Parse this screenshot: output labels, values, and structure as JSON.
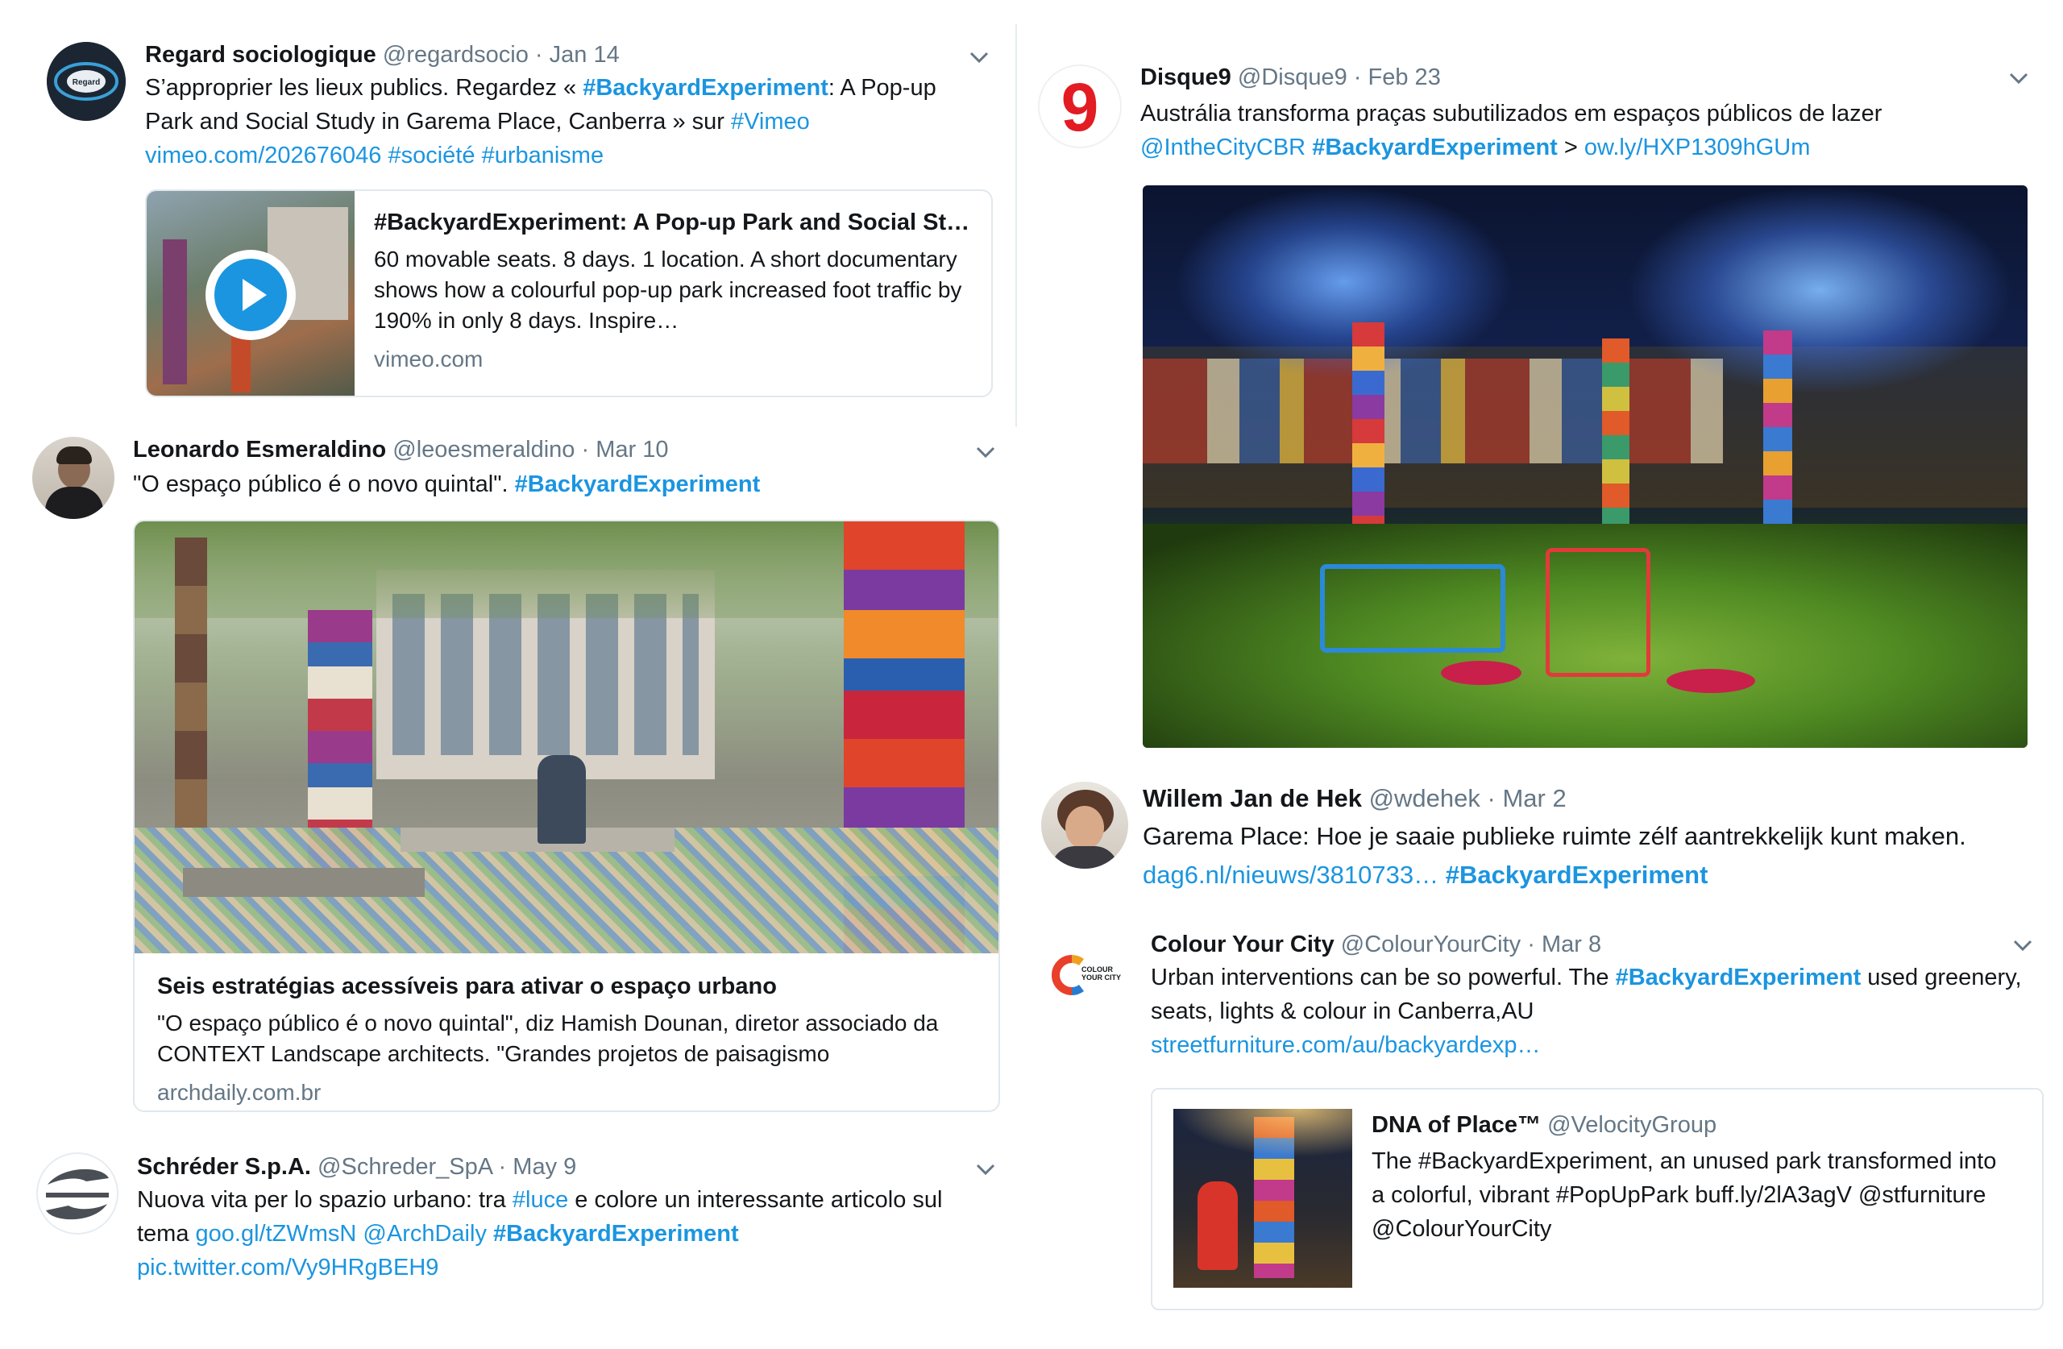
{
  "tweets": [
    {
      "name": "Regard sociologique",
      "handle": "@regardsocio",
      "sep": "·",
      "date": "Jan 14",
      "avatar_label": "Regard",
      "text": {
        "p1": "S’approprier les lieux publics.  Regardez « ",
        "tag1": "#BackyardExperiment",
        "p2": ": A Pop-up Park and Social Study in Garema Place, Canberra » sur ",
        "tag2": "#Vimeo",
        "link1": "vimeo.com/202676046",
        "tag3": "#société",
        "tag4": "#urbanisme"
      },
      "card": {
        "title": "#BackyardExperiment: A Pop-up Park and Social St…",
        "description": "60 movable seats. 8 days. 1 location. A short documentary shows how a colourful pop-up park increased foot traffic by 190% in only 8 days. Inspire…",
        "domain": "vimeo.com",
        "play_icon": "play-icon"
      }
    },
    {
      "name": "Leonardo Esmeraldino",
      "handle": "@leoesmeraldino",
      "sep": "·",
      "date": "Mar 10",
      "text": {
        "p1": "\"O espaço público é o novo quintal\". ",
        "tag1": "#BackyardExperiment"
      },
      "card": {
        "title": "Seis estratégias acessíveis para ativar o espaço urbano",
        "description": "\"O espaço público é o novo quintal\", diz Hamish Dounan, diretor associado da CONTEXT Landscape architects. \"Grandes projetos de paisagismo",
        "domain": "archdaily.com.br"
      }
    },
    {
      "name": "Schréder S.p.A.",
      "handle": "@Schreder_SpA",
      "sep": "·",
      "date": "May 9",
      "text": {
        "p1": "Nuova vita per lo spazio urbano: tra ",
        "tag1": "#luce",
        "p2": " e colore un interessante articolo sul tema ",
        "link1": "goo.gl/tZWmsN",
        "link2": "@ArchDaily",
        "tag2": "#BackyardExperiment",
        "link3": "pic.twitter.com/Vy9HRgBEH9"
      }
    },
    {
      "name": "Disque9",
      "handle": "@Disque9",
      "sep": "·",
      "date": "Feb 23",
      "avatar_label": "9",
      "text": {
        "p1": "Austrália transforma praças subutilizados em espaços públicos de lazer",
        "link1": "@IntheCityCBR",
        "tag1": "#BackyardExperiment",
        "p2": " > ",
        "link2": "ow.ly/HXP1309hGUm"
      }
    },
    {
      "name": "Willem Jan de Hek",
      "handle": "@wdehek",
      "sep": "·",
      "date": "Mar 2",
      "text": {
        "p1": "Garema Place: Hoe je saaie publieke ruimte zélf aantrekkelijk kunt maken.",
        "link1": "dag6.nl/nieuws/3810733…",
        "tag1": "#BackyardExperiment"
      }
    },
    {
      "name": "Colour Your City",
      "handle": "@ColourYourCity",
      "sep": "·",
      "date": "Mar 8",
      "avatar_label": "COLOUR YOUR CITY",
      "text": {
        "p1": "Urban interventions can be so powerful. The ",
        "tag1": "#BackyardExperiment",
        "p2": " used greenery, seats, lights & colour in Canberra,AU",
        "link1": "streetfurniture.com/au/backyardexp…"
      },
      "quote": {
        "name": "DNA of Place™",
        "handle": "@VelocityGroup",
        "text": "The #BackyardExperiment, an unused park transformed into a colorful, vibrant #PopUpPark buff.ly/2lA3agV @stfurniture @ColourYourCity"
      }
    }
  ],
  "colors": {
    "link": "#1b95e0",
    "secondary_text": "#657786",
    "border": "#e1e8ed"
  },
  "icons": {
    "caret": "chevron-down-icon"
  }
}
